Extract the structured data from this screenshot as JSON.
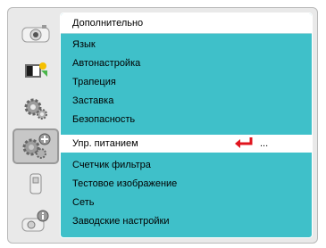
{
  "sidebar": {
    "items": [
      {
        "icon": "picture-icon"
      },
      {
        "icon": "screen-color-icon"
      },
      {
        "icon": "settings-gear-icon"
      },
      {
        "icon": "advanced-settings-icon",
        "active": true
      },
      {
        "icon": "usb-icon"
      },
      {
        "icon": "information-icon"
      }
    ]
  },
  "menu": {
    "header": "Дополнительно",
    "items": [
      "Язык",
      "Автонастройка",
      "Трапеция",
      "Заставка",
      "Безопасность",
      "Упр. питанием",
      "Счетчик фильтра",
      "Тестовое изображение",
      "Сеть",
      "Заводские настройки"
    ],
    "selected_index": 5,
    "selected_value": "..."
  },
  "colors": {
    "panel": "#3fc0c9",
    "accent_arrow": "#e0141e"
  }
}
